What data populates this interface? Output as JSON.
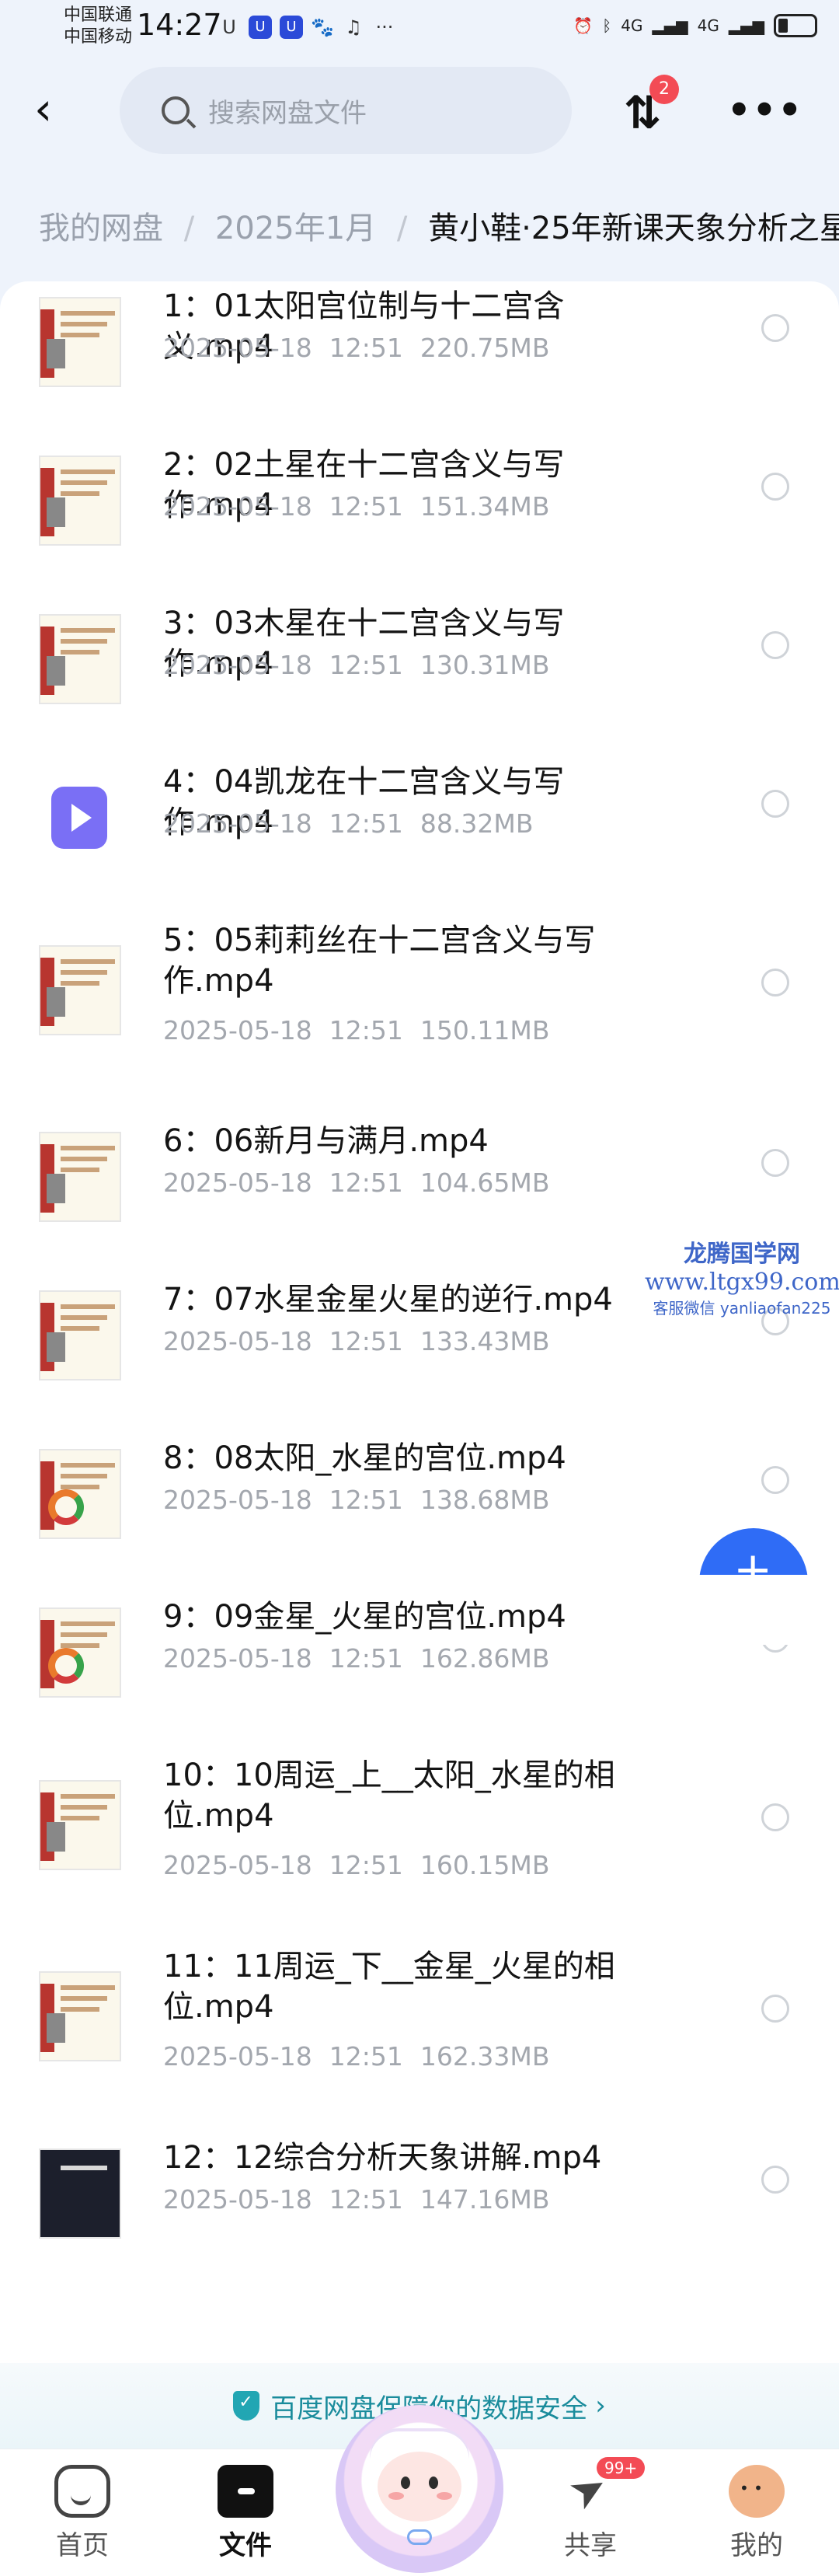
{
  "status_bar": {
    "carrier1": "中国联通",
    "carrier2": "中国移动",
    "time": "14:27",
    "left_icons": [
      "U",
      "U",
      "U"
    ],
    "network": "4G",
    "network2": "4G"
  },
  "topbar": {
    "search_placeholder": "搜索网盘文件",
    "transfer_badge": "2"
  },
  "breadcrumb": {
    "items": [
      "我的网盘",
      "2025年1月"
    ],
    "current": "黄小鞋·25年新课天象分析之星"
  },
  "files": [
    {
      "name": "1：01太阳宫位制与十二宫含义.mp4",
      "date": "2025-05-18",
      "time": "12:51",
      "size": "220.75MB",
      "thumb": "slide"
    },
    {
      "name": "2：02土星在十二宫含义与写作.mp4",
      "date": "2025-05-18",
      "time": "12:51",
      "size": "151.34MB",
      "thumb": "slide"
    },
    {
      "name": "3：03木星在十二宫含义与写作.mp4",
      "date": "2025-05-18",
      "time": "12:51",
      "size": "130.31MB",
      "thumb": "slide"
    },
    {
      "name": "4：04凯龙在十二宫含义与写作.mp4",
      "date": "2025-05-18",
      "time": "12:51",
      "size": "88.32MB",
      "thumb": "video-icon"
    },
    {
      "name": "5：05莉莉丝在十二宫含义与写作.mp4",
      "date": "2025-05-18",
      "time": "12:51",
      "size": "150.11MB",
      "thumb": "slide"
    },
    {
      "name": "6：06新月与满月.mp4",
      "date": "2025-05-18",
      "time": "12:51",
      "size": "104.65MB",
      "thumb": "slide"
    },
    {
      "name": "7：07水星金星火星的逆行.mp4",
      "date": "2025-05-18",
      "time": "12:51",
      "size": "133.43MB",
      "thumb": "slide"
    },
    {
      "name": "8：08太阳_水星的宫位.mp4",
      "date": "2025-05-18",
      "time": "12:51",
      "size": "138.68MB",
      "thumb": "wheel"
    },
    {
      "name": "9：09金星_火星的宫位.mp4",
      "date": "2025-05-18",
      "time": "12:51",
      "size": "162.86MB",
      "thumb": "wheel"
    },
    {
      "name": "10：10周运_上__太阳_水星的相位.mp4",
      "date": "2025-05-18",
      "time": "12:51",
      "size": "160.15MB",
      "thumb": "slide"
    },
    {
      "name": "11：11周运_下__金星_火星的相位.mp4",
      "date": "2025-05-18",
      "time": "12:51",
      "size": "162.33MB",
      "thumb": "slide"
    },
    {
      "name": "12：12综合分析天象讲解.mp4",
      "date": "2025-05-18",
      "time": "12:51",
      "size": "147.16MB",
      "thumb": "dark"
    }
  ],
  "watermark": {
    "line1": "龙腾国学网",
    "line2": "www.ltgx99.com",
    "line3": "客服微信 yanliaofan225"
  },
  "security_banner": "百度网盘保障你的数据安全",
  "bottom_nav": {
    "home": "首页",
    "files": "文件",
    "share": "共享",
    "share_badge": "99+",
    "me": "我的"
  },
  "colors": {
    "accent": "#2f6cf6",
    "badge": "#f34b55",
    "security_text": "#1a8c9c"
  }
}
